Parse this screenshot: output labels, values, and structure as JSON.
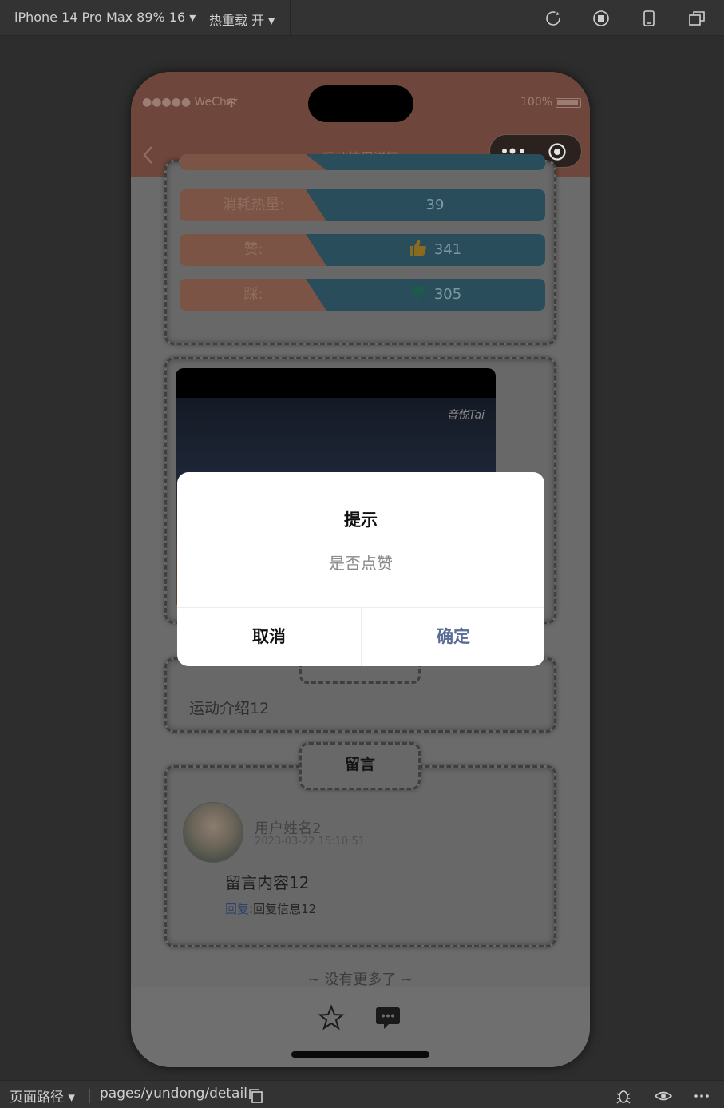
{
  "toolbar": {
    "device_label": "iPhone 14 Pro Max 89% 16 ▾",
    "hot_reload_label": "热重载 开 ▾"
  },
  "phone": {
    "status_left": "●●●●● WeChat",
    "status_right": "100%",
    "nav_title": "运动教程详情"
  },
  "stats": [
    {
      "label": "消耗热量:",
      "value": "39",
      "icon": ""
    },
    {
      "label": "赞:",
      "value": "341",
      "icon": "thumbs-up-icon"
    },
    {
      "label": "踩:",
      "value": "305",
      "icon": "thumbs-down-icon"
    }
  ],
  "video": {
    "watermark": "音悦Tai"
  },
  "intro": {
    "text": "运动介绍12"
  },
  "comments": {
    "tab_label": "留言",
    "user_name": "用户姓名2",
    "time": "2023-03-22 15:10:51",
    "content": "留言内容12",
    "reply_label": "回复",
    "reply_text": ":回复信息12"
  },
  "list_end": "~ 没有更多了 ~",
  "dialog": {
    "title": "提示",
    "message": "是否点赞",
    "cancel_label": "取消",
    "confirm_label": "确定"
  },
  "footer": {
    "path_label": "页面路径 ▾",
    "path": "pages/yundong/detail"
  },
  "colors": {
    "accent_link": "#576b95",
    "stat_label": "#7b5445",
    "stat_value": "#2a4d5b"
  }
}
